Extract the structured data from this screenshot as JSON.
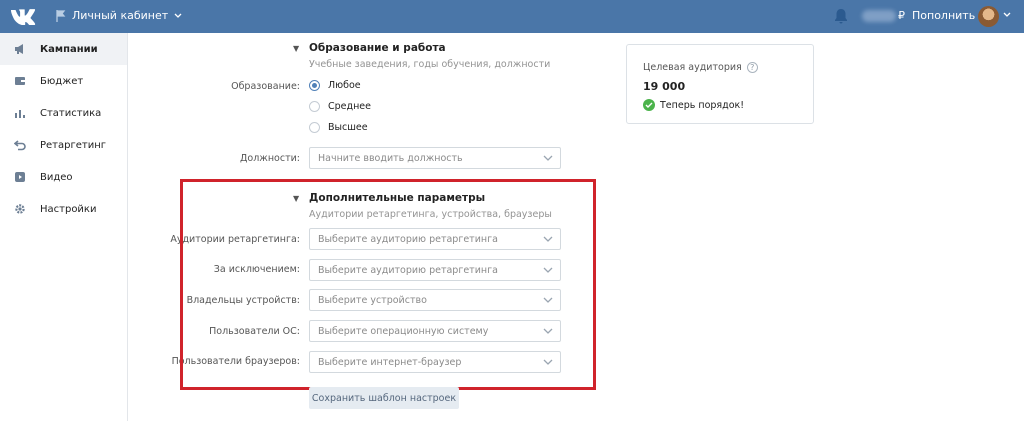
{
  "header": {
    "cabinet_label": "Личный кабинет",
    "balance_currency": "₽",
    "topup_label": "Пополнить"
  },
  "sidebar": {
    "items": [
      {
        "label": "Кампании",
        "icon": "megaphone-icon",
        "active": true
      },
      {
        "label": "Бюджет",
        "icon": "wallet-icon",
        "active": false
      },
      {
        "label": "Статистика",
        "icon": "bar-chart-icon",
        "active": false
      },
      {
        "label": "Ретаргетинг",
        "icon": "retarget-icon",
        "active": false
      },
      {
        "label": "Видео",
        "icon": "video-icon",
        "active": false
      },
      {
        "label": "Настройки",
        "icon": "gear-icon",
        "active": false
      }
    ]
  },
  "education": {
    "title": "Образование и работа",
    "subtitle": "Учебные заведения, годы обучения, должности",
    "education_label": "Образование:",
    "options": [
      "Любое",
      "Среднее",
      "Высшее"
    ],
    "selected": "Любое",
    "positions_label": "Должности:",
    "positions_placeholder": "Начните вводить должность"
  },
  "extra": {
    "title": "Дополнительные параметры",
    "subtitle": "Аудитории ретаргетинга, устройства, браузеры",
    "fields": [
      {
        "label": "Аудитории ретаргетинга:",
        "placeholder": "Выберите аудиторию ретаргетинга"
      },
      {
        "label": "За исключением:",
        "placeholder": "Выберите аудиторию ретаргетинга"
      },
      {
        "label": "Владельцы устройств:",
        "placeholder": "Выберите устройство"
      },
      {
        "label": "Пользователи ОС:",
        "placeholder": "Выберите операционную систему"
      },
      {
        "label": "Пользователи браузеров:",
        "placeholder": "Выберите интернет-браузер"
      }
    ]
  },
  "save_template_label": "Сохранить шаблон настроек",
  "audience": {
    "title": "Целевая аудитория",
    "count": "19 000",
    "status": "Теперь порядок!"
  },
  "colors": {
    "header_bg": "#4a76a8",
    "highlight_frame": "#d0232b",
    "accent": "#5181b8",
    "success": "#4bb34b"
  }
}
